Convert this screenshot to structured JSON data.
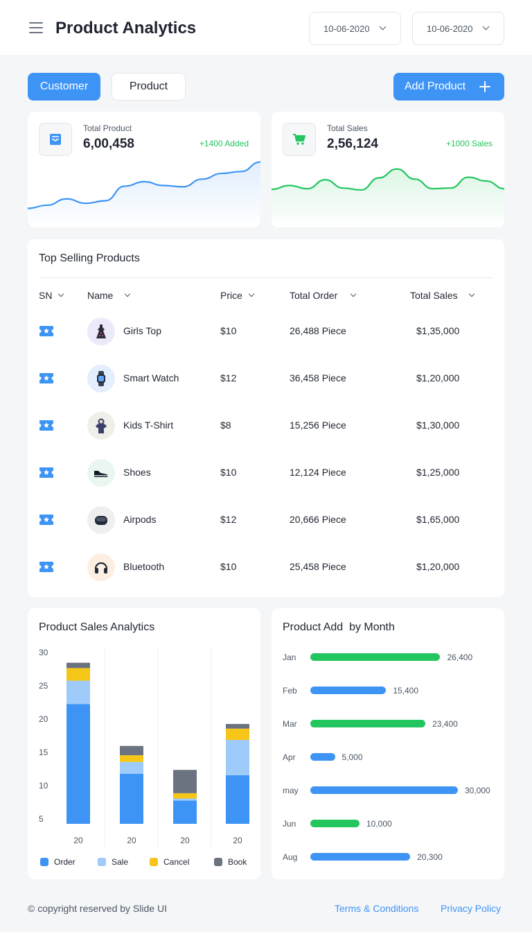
{
  "header": {
    "title": "Product Analytics",
    "date_from": "10-06-2020",
    "date_to": "10-06-2020"
  },
  "tabs": [
    {
      "label": "Customer",
      "active": true
    },
    {
      "label": "Product",
      "active": false
    }
  ],
  "add_product_label": "Add Product",
  "stats": [
    {
      "label": "Total Product",
      "value": "6,00,458",
      "delta": "+1400 Added",
      "icon": "inbox-icon",
      "color": "#3e94f5"
    },
    {
      "label": "Total Sales",
      "value": "2,56,124",
      "delta": "+1000 Sales",
      "icon": "cart-icon",
      "color": "#22c55e"
    }
  ],
  "top_selling": {
    "title": "Top Selling Products",
    "columns": [
      "SN",
      "Name",
      "Price",
      "Total Order",
      "Total Sales"
    ],
    "rows": [
      {
        "name": "Girls Top",
        "price": "$10",
        "orders": "26,488 Piece",
        "sales": "$1,35,000",
        "icon": "dress-icon",
        "bg": "#ece9fb"
      },
      {
        "name": "Smart Watch",
        "price": "$12",
        "orders": "36,458 Piece",
        "sales": "$1,20,000",
        "icon": "watch-icon",
        "bg": "#e5eefc"
      },
      {
        "name": "Kids T-Shirt",
        "price": "$8",
        "orders": "15,256 Piece",
        "sales": "$1,30,000",
        "icon": "tshirt-icon",
        "bg": "#efefe9"
      },
      {
        "name": "Shoes",
        "price": "$10",
        "orders": "12,124 Piece",
        "sales": "$1,25,000",
        "icon": "shoe-icon",
        "bg": "#e9f7f0"
      },
      {
        "name": "Airpods",
        "price": "$12",
        "orders": "20,666 Piece",
        "sales": "$1,65,000",
        "icon": "airpods-icon",
        "bg": "#efefef"
      },
      {
        "name": "Bluetooth",
        "price": "$10",
        "orders": "25,458 Piece",
        "sales": "$1,20,000",
        "icon": "headphones-icon",
        "bg": "#fdeee2"
      }
    ]
  },
  "sales_analytics": {
    "title": "Product Sales Analytics",
    "legend": [
      "Order",
      "Sale",
      "Cancel",
      "Book"
    ]
  },
  "monthly": {
    "title": "Product Add  by Month"
  },
  "colors": {
    "accent": "#3e94f5",
    "green": "#22c55e",
    "order": "#3e94f5",
    "sale": "#9fcbfb",
    "cancel": "#f5c518",
    "book": "#6b7280"
  },
  "chart_data": [
    {
      "type": "line",
      "series": [
        {
          "values": [
            3,
            3.5,
            4.5,
            3.8,
            4.2,
            6.5,
            7.2,
            6.6,
            6.4,
            7.6,
            8.5,
            8.8,
            10.3
          ]
        }
      ]
    },
    {
      "type": "line",
      "series": [
        {
          "values": [
            6,
            6.6,
            6.1,
            7.5,
            6.2,
            5.9,
            7.8,
            9.2,
            7.6,
            6.1,
            6.2,
            7.9,
            7.3,
            6.1
          ]
        }
      ]
    },
    {
      "type": "bar",
      "stacked": true,
      "categories": [
        "20",
        "20",
        "20",
        "20"
      ],
      "series": [
        {
          "name": "Order",
          "values": [
            18,
            7.5,
            3.5,
            7.3
          ]
        },
        {
          "name": "Sale",
          "values": [
            3.5,
            1.8,
            0.3,
            5.3
          ]
        },
        {
          "name": "Cancel",
          "values": [
            1.9,
            1.0,
            0.8,
            1.7
          ]
        },
        {
          "name": "Book",
          "values": [
            0.8,
            1.4,
            3.5,
            0.7
          ]
        }
      ],
      "yticks": [
        "30",
        "25",
        "20",
        "15",
        "10",
        "5"
      ],
      "ylim": [
        5,
        30
      ]
    },
    {
      "type": "bar",
      "orientation": "horizontal",
      "categories": [
        "Jan",
        "Feb",
        "Mar",
        "Apr",
        "may",
        "Jun",
        "Aug"
      ],
      "values": [
        26400,
        15400,
        23400,
        5000,
        30000,
        10000,
        20300
      ],
      "labels": [
        "26,400",
        "15,400",
        "23,400",
        "5,000",
        "30,000",
        "10,000",
        "20,300"
      ],
      "colors": [
        "green",
        "blue",
        "green",
        "blue",
        "blue",
        "green",
        "blue"
      ],
      "xlim": [
        0,
        30000
      ]
    }
  ],
  "footer": {
    "copyright": "© copyright reserved by Slide UI",
    "terms": "Terms & Conditions",
    "privacy": "Privacy Policy"
  }
}
